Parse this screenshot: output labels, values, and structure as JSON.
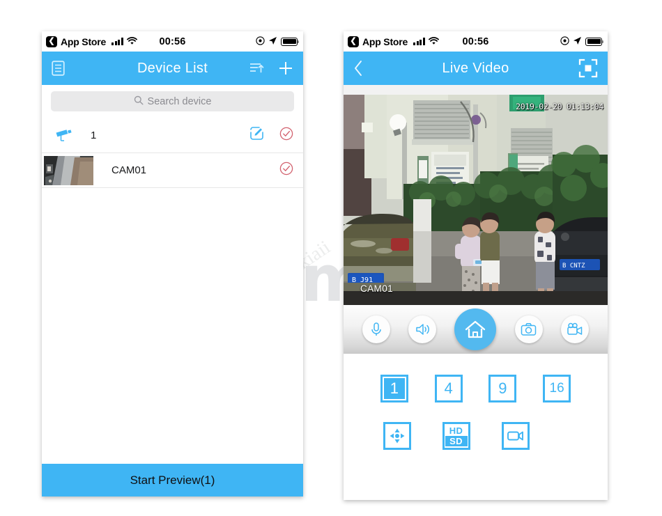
{
  "watermark": {
    "word": "Yum",
    "registered": "®",
    "url": "http://yumikiaii"
  },
  "left_phone": {
    "status_bar": {
      "back_glyph": "❮",
      "carrier_app": "App Store",
      "time": "00:56",
      "signal_icon": "signal-bars-icon",
      "wifi_icon": "wifi-icon",
      "location_icon": "location-arrow-icon",
      "alarm_icon": "do-not-disturb-icon",
      "battery_icon": "battery-full-icon"
    },
    "navbar": {
      "menu_icon": "list-menu-icon",
      "title": "Device List",
      "sort_icon": "sort-ascending-icon",
      "add_icon": "plus-icon"
    },
    "search": {
      "icon": "search-icon",
      "placeholder": "Search device"
    },
    "rows": [
      {
        "kind": "group",
        "icon": "cctv-camera-icon",
        "label": "1",
        "edit_icon": "edit-pencil-icon",
        "check_icon": "check-circle-icon"
      },
      {
        "kind": "device",
        "icon": "camera-thumbnail",
        "label": "CAM01",
        "check_icon": "check-circle-icon"
      }
    ],
    "cta_label": "Start Preview(1)"
  },
  "right_phone": {
    "status_bar": {
      "back_glyph": "❮",
      "carrier_app": "App Store",
      "time": "00:56",
      "signal_icon": "signal-bars-icon",
      "wifi_icon": "wifi-icon",
      "location_icon": "location-arrow-icon",
      "alarm_icon": "do-not-disturb-icon",
      "battery_icon": "battery-full-icon"
    },
    "navbar": {
      "back_icon": "chevron-left-icon",
      "title": "Live Video",
      "fullscreen_icon": "fullscreen-expand-icon"
    },
    "video": {
      "timestamp": "2019-02-20 01:13:04",
      "channel_label": "CAM01"
    },
    "controls": [
      {
        "name": "microphone-button",
        "icon": "microphone-icon",
        "active": false
      },
      {
        "name": "speaker-button",
        "icon": "speaker-volume-icon",
        "active": false
      },
      {
        "name": "home-button",
        "icon": "home-icon",
        "active": true
      },
      {
        "name": "snapshot-button",
        "icon": "photo-camera-icon",
        "active": false
      },
      {
        "name": "record-button",
        "icon": "video-camera-icon",
        "active": false
      }
    ],
    "modes_row1": [
      {
        "label": "1",
        "selected": true
      },
      {
        "label": "4",
        "selected": false
      },
      {
        "label": "9",
        "selected": false
      },
      {
        "label": "16",
        "selected": false
      }
    ],
    "modes_row2": [
      {
        "name": "ptz-button",
        "icon": "directional-pad-icon"
      },
      {
        "name": "quality-button",
        "hd": "HD",
        "sd": "SD"
      },
      {
        "name": "playback-button",
        "icon": "video-camera-icon"
      }
    ]
  },
  "colors": {
    "accent": "#3fb5f4",
    "primary_button": "#53b9ef",
    "check_red": "#d2616e",
    "search_bg": "#e9e9ea"
  }
}
